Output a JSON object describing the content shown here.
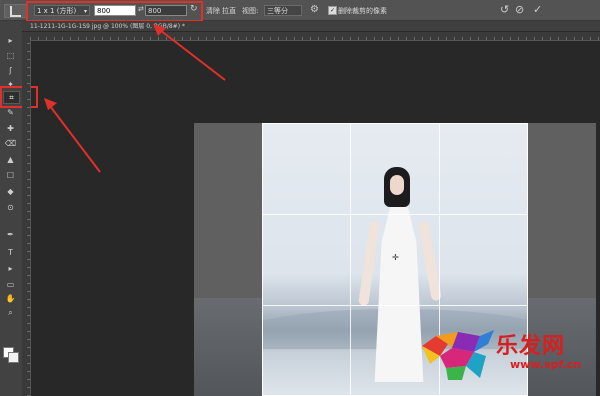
{
  "options_bar": {
    "ratio_select": "1 x 1 (方形)",
    "width_value": "800",
    "swap_symbol": "⇄",
    "height_value": "800",
    "clear_label": "清除",
    "straighten_label": "拉直",
    "view_label": "视图:",
    "view_value": "三等分",
    "delete_pixels_label": "删除裁剪的像素",
    "checkbox_mark": "✓"
  },
  "document_tab": {
    "title": "11-1211-1G-1G-1S9 jpg @ 100% (图层 0, RGB/8#) *"
  },
  "toolbar": {
    "tools": [
      "▸",
      "⬚",
      "ʃ",
      "✦",
      "⌗",
      "✎",
      "✚",
      "⌫",
      "▲",
      "☐",
      "◆",
      "⊙",
      "✒",
      "T",
      "▸",
      "▭",
      "✋",
      "⌕"
    ]
  },
  "watermark": {
    "brand_text": "乐发网",
    "url": "www.spf.cn"
  },
  "colors": {
    "highlight_red": "#e0302a",
    "watermark_red": "#d81e1e"
  }
}
